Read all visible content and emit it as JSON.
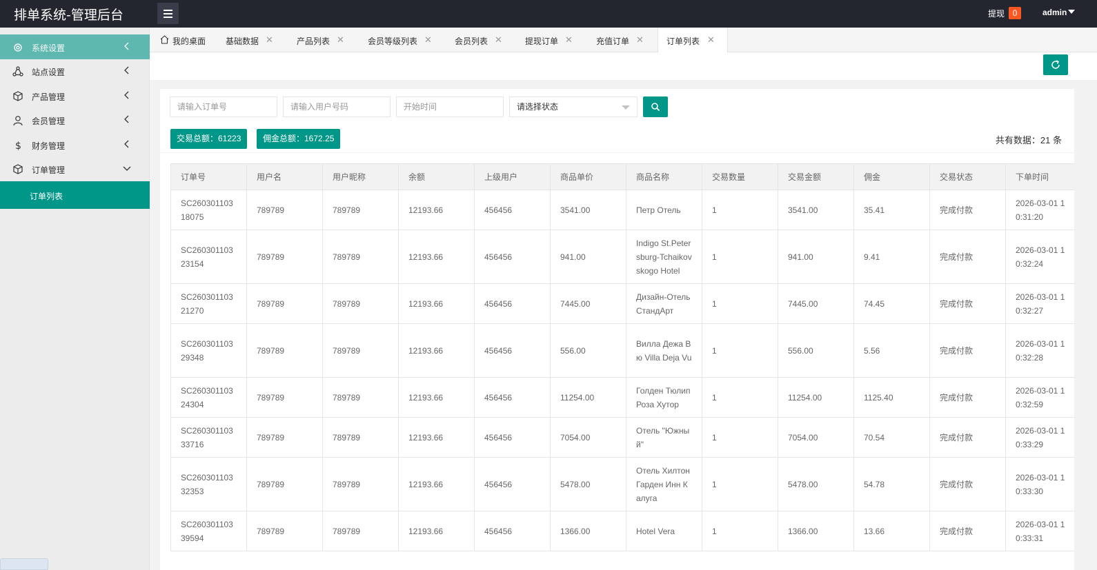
{
  "header": {
    "title": "排单系统-管理后台",
    "withdraw_label": "提现",
    "withdraw_count": "0",
    "user": "admin"
  },
  "sidebar": {
    "items": [
      {
        "label": "系统设置",
        "icon": "gear-icon"
      },
      {
        "label": "站点设置",
        "icon": "site-icon"
      },
      {
        "label": "产品管理",
        "icon": "box-icon"
      },
      {
        "label": "会员管理",
        "icon": "user-icon"
      },
      {
        "label": "财务管理",
        "icon": "dollar-icon"
      },
      {
        "label": "订单管理",
        "icon": "box-icon"
      }
    ],
    "sub_item": "订单列表"
  },
  "tabs": [
    {
      "label": "我的桌面"
    },
    {
      "label": "基础数据"
    },
    {
      "label": "产品列表"
    },
    {
      "label": "会员等级列表"
    },
    {
      "label": "会员列表"
    },
    {
      "label": "提现订单"
    },
    {
      "label": "充值订单"
    },
    {
      "label": "订单列表"
    }
  ],
  "filters": {
    "order_no_placeholder": "请输入订单号",
    "user_no_placeholder": "请输入用户号码",
    "start_time_placeholder": "开始时间",
    "status_select": "请选择状态"
  },
  "stats": {
    "trade_total": "交易总额：61223",
    "commission_total": "佣金总额：1672.25",
    "record_count": "共有数据：21 条"
  },
  "table": {
    "headers": [
      "订单号",
      "用户名",
      "用户昵称",
      "余额",
      "上级用户",
      "商品单价",
      "商品名称",
      "交易数量",
      "交易金额",
      "佣金",
      "交易状态",
      "下单时间"
    ],
    "rows": [
      [
        "SC26030110318075",
        "789789",
        "789789",
        "12193.66",
        "456456",
        "3541.00",
        "Петр Отель",
        "1",
        "3541.00",
        "35.41",
        "完成付款",
        "2026-03-01 10:31:20"
      ],
      [
        "SC26030110323154",
        "789789",
        "789789",
        "12193.66",
        "456456",
        "941.00",
        "Indigo St.Petersburg-Tchaikovskogo Hotel",
        "1",
        "941.00",
        "9.41",
        "完成付款",
        "2026-03-01 10:32:24"
      ],
      [
        "SC26030110321270",
        "789789",
        "789789",
        "12193.66",
        "456456",
        "7445.00",
        "Дизайн-Отель СтандАрт",
        "1",
        "7445.00",
        "74.45",
        "完成付款",
        "2026-03-01 10:32:27"
      ],
      [
        "SC26030110329348",
        "789789",
        "789789",
        "12193.66",
        "456456",
        "556.00",
        "Вилла Дежа Вю Villa Deja Vu",
        "1",
        "556.00",
        "5.56",
        "完成付款",
        "2026-03-01 10:32:28"
      ],
      [
        "SC26030110324304",
        "789789",
        "789789",
        "12193.66",
        "456456",
        "11254.00",
        "Голден Тюлип Роза Хутор",
        "1",
        "11254.00",
        "1125.40",
        "完成付款",
        "2026-03-01 10:32:59"
      ],
      [
        "SC26030110333716",
        "789789",
        "789789",
        "12193.66",
        "456456",
        "7054.00",
        "Отель \"Южный\"",
        "1",
        "7054.00",
        "70.54",
        "完成付款",
        "2026-03-01 10:33:29"
      ],
      [
        "SC26030110332353",
        "789789",
        "789789",
        "12193.66",
        "456456",
        "5478.00",
        "Отель Хилтон Гарден Инн Калуга",
        "1",
        "5478.00",
        "54.78",
        "完成付款",
        "2026-03-01 10:33:30"
      ],
      [
        "SC26030110339594",
        "789789",
        "789789",
        "12193.66",
        "456456",
        "1366.00",
        "Hotel Vera",
        "1",
        "1366.00",
        "13.66",
        "完成付款",
        "2026-03-01 10:33:31"
      ]
    ]
  },
  "colors": {
    "accent": "#009688",
    "header_bg": "#23262e",
    "badge": "#ff5722"
  }
}
